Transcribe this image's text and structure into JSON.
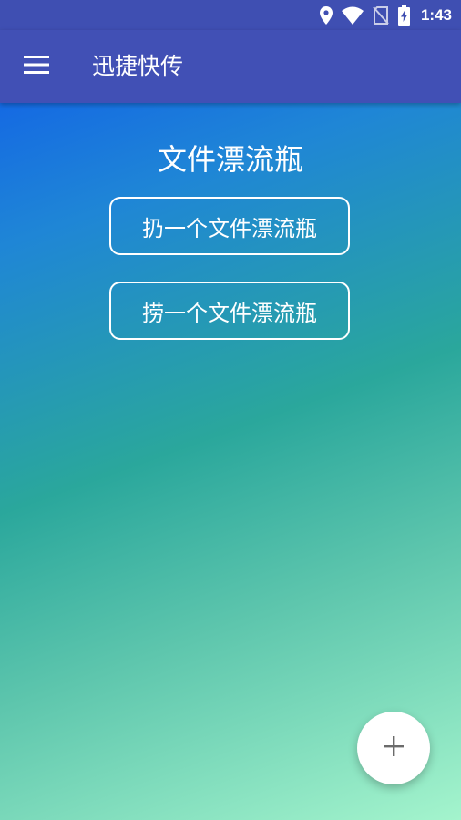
{
  "status_bar": {
    "time": "1:43",
    "icons": [
      "location-icon",
      "wifi-icon",
      "no-sim-icon",
      "battery-charging-icon"
    ]
  },
  "app_bar": {
    "menu_icon": "hamburger-menu-icon",
    "title": "迅捷快传"
  },
  "main": {
    "heading": "文件漂流瓶",
    "throw_button_label": "扔一个文件漂流瓶",
    "pick_button_label": "捞一个文件漂流瓶"
  },
  "fab": {
    "icon": "plus-icon"
  },
  "colors": {
    "status_bar": "#3f4fb2",
    "app_bar": "#4150b5",
    "gradient_start": "#0d55ec",
    "gradient_middle": "#2aa79c",
    "gradient_end": "#a4f4cd",
    "fab_background": "#ffffff",
    "fab_icon": "#6b6b6b"
  }
}
